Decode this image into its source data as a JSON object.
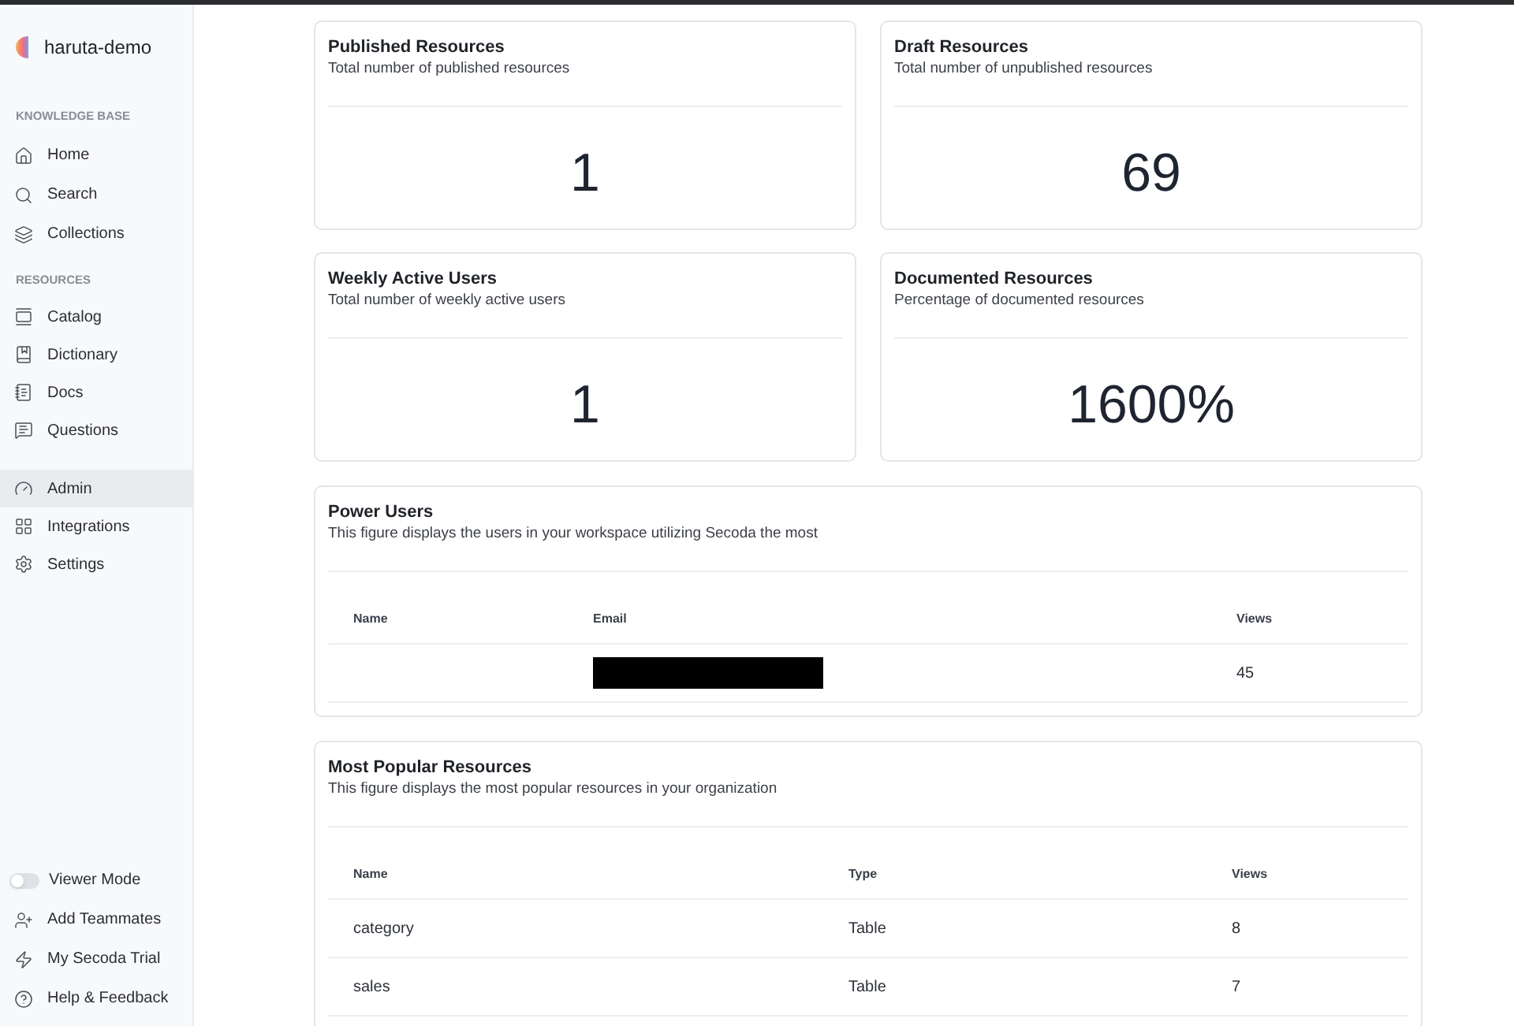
{
  "workspace": {
    "name": "haruta-demo"
  },
  "sidebar": {
    "sections": [
      {
        "heading": "KNOWLEDGE BASE",
        "items": [
          {
            "label": "Home",
            "selected": false
          },
          {
            "label": "Search",
            "selected": false
          },
          {
            "label": "Collections",
            "selected": false
          }
        ]
      },
      {
        "heading": "RESOURCES",
        "items": [
          {
            "label": "Catalog",
            "selected": false
          },
          {
            "label": "Dictionary",
            "selected": false
          },
          {
            "label": "Docs",
            "selected": false
          },
          {
            "label": "Questions",
            "selected": false
          }
        ]
      },
      {
        "items": [
          {
            "label": "Admin",
            "selected": true
          },
          {
            "label": "Integrations",
            "selected": false
          },
          {
            "label": "Settings",
            "selected": false
          }
        ]
      }
    ],
    "footer": [
      {
        "kind": "toggle",
        "label": "Viewer Mode",
        "on": false
      },
      {
        "kind": "link",
        "label": "Add Teammates"
      },
      {
        "kind": "link",
        "label": "My Secoda Trial"
      },
      {
        "kind": "link",
        "label": "Help & Feedback"
      }
    ]
  },
  "stat_cards": [
    {
      "title": "Published Resources",
      "subtitle": "Total number of published resources",
      "value": "1"
    },
    {
      "title": "Draft Resources",
      "subtitle": "Total number of unpublished resources",
      "value": "69"
    },
    {
      "title": "Weekly Active Users",
      "subtitle": "Total number of weekly active users",
      "value": "1"
    },
    {
      "title": "Documented Resources",
      "subtitle": "Percentage of documented resources",
      "value": "1600%"
    }
  ],
  "power_users": {
    "title": "Power Users",
    "subtitle": "This figure displays the users in your workspace utilizing Secoda the most",
    "columns": [
      "Name",
      "Email",
      "Views"
    ],
    "rows": [
      {
        "email_redacted": true,
        "views": "45"
      }
    ]
  },
  "popular_resources": {
    "title": "Most Popular Resources",
    "subtitle": "This figure displays the most popular resources in your organization",
    "columns": [
      "Name",
      "Type",
      "Views"
    ],
    "rows": [
      {
        "name": "category",
        "type": "Table",
        "views": "8"
      },
      {
        "name": "sales",
        "type": "Table",
        "views": "7"
      }
    ]
  }
}
